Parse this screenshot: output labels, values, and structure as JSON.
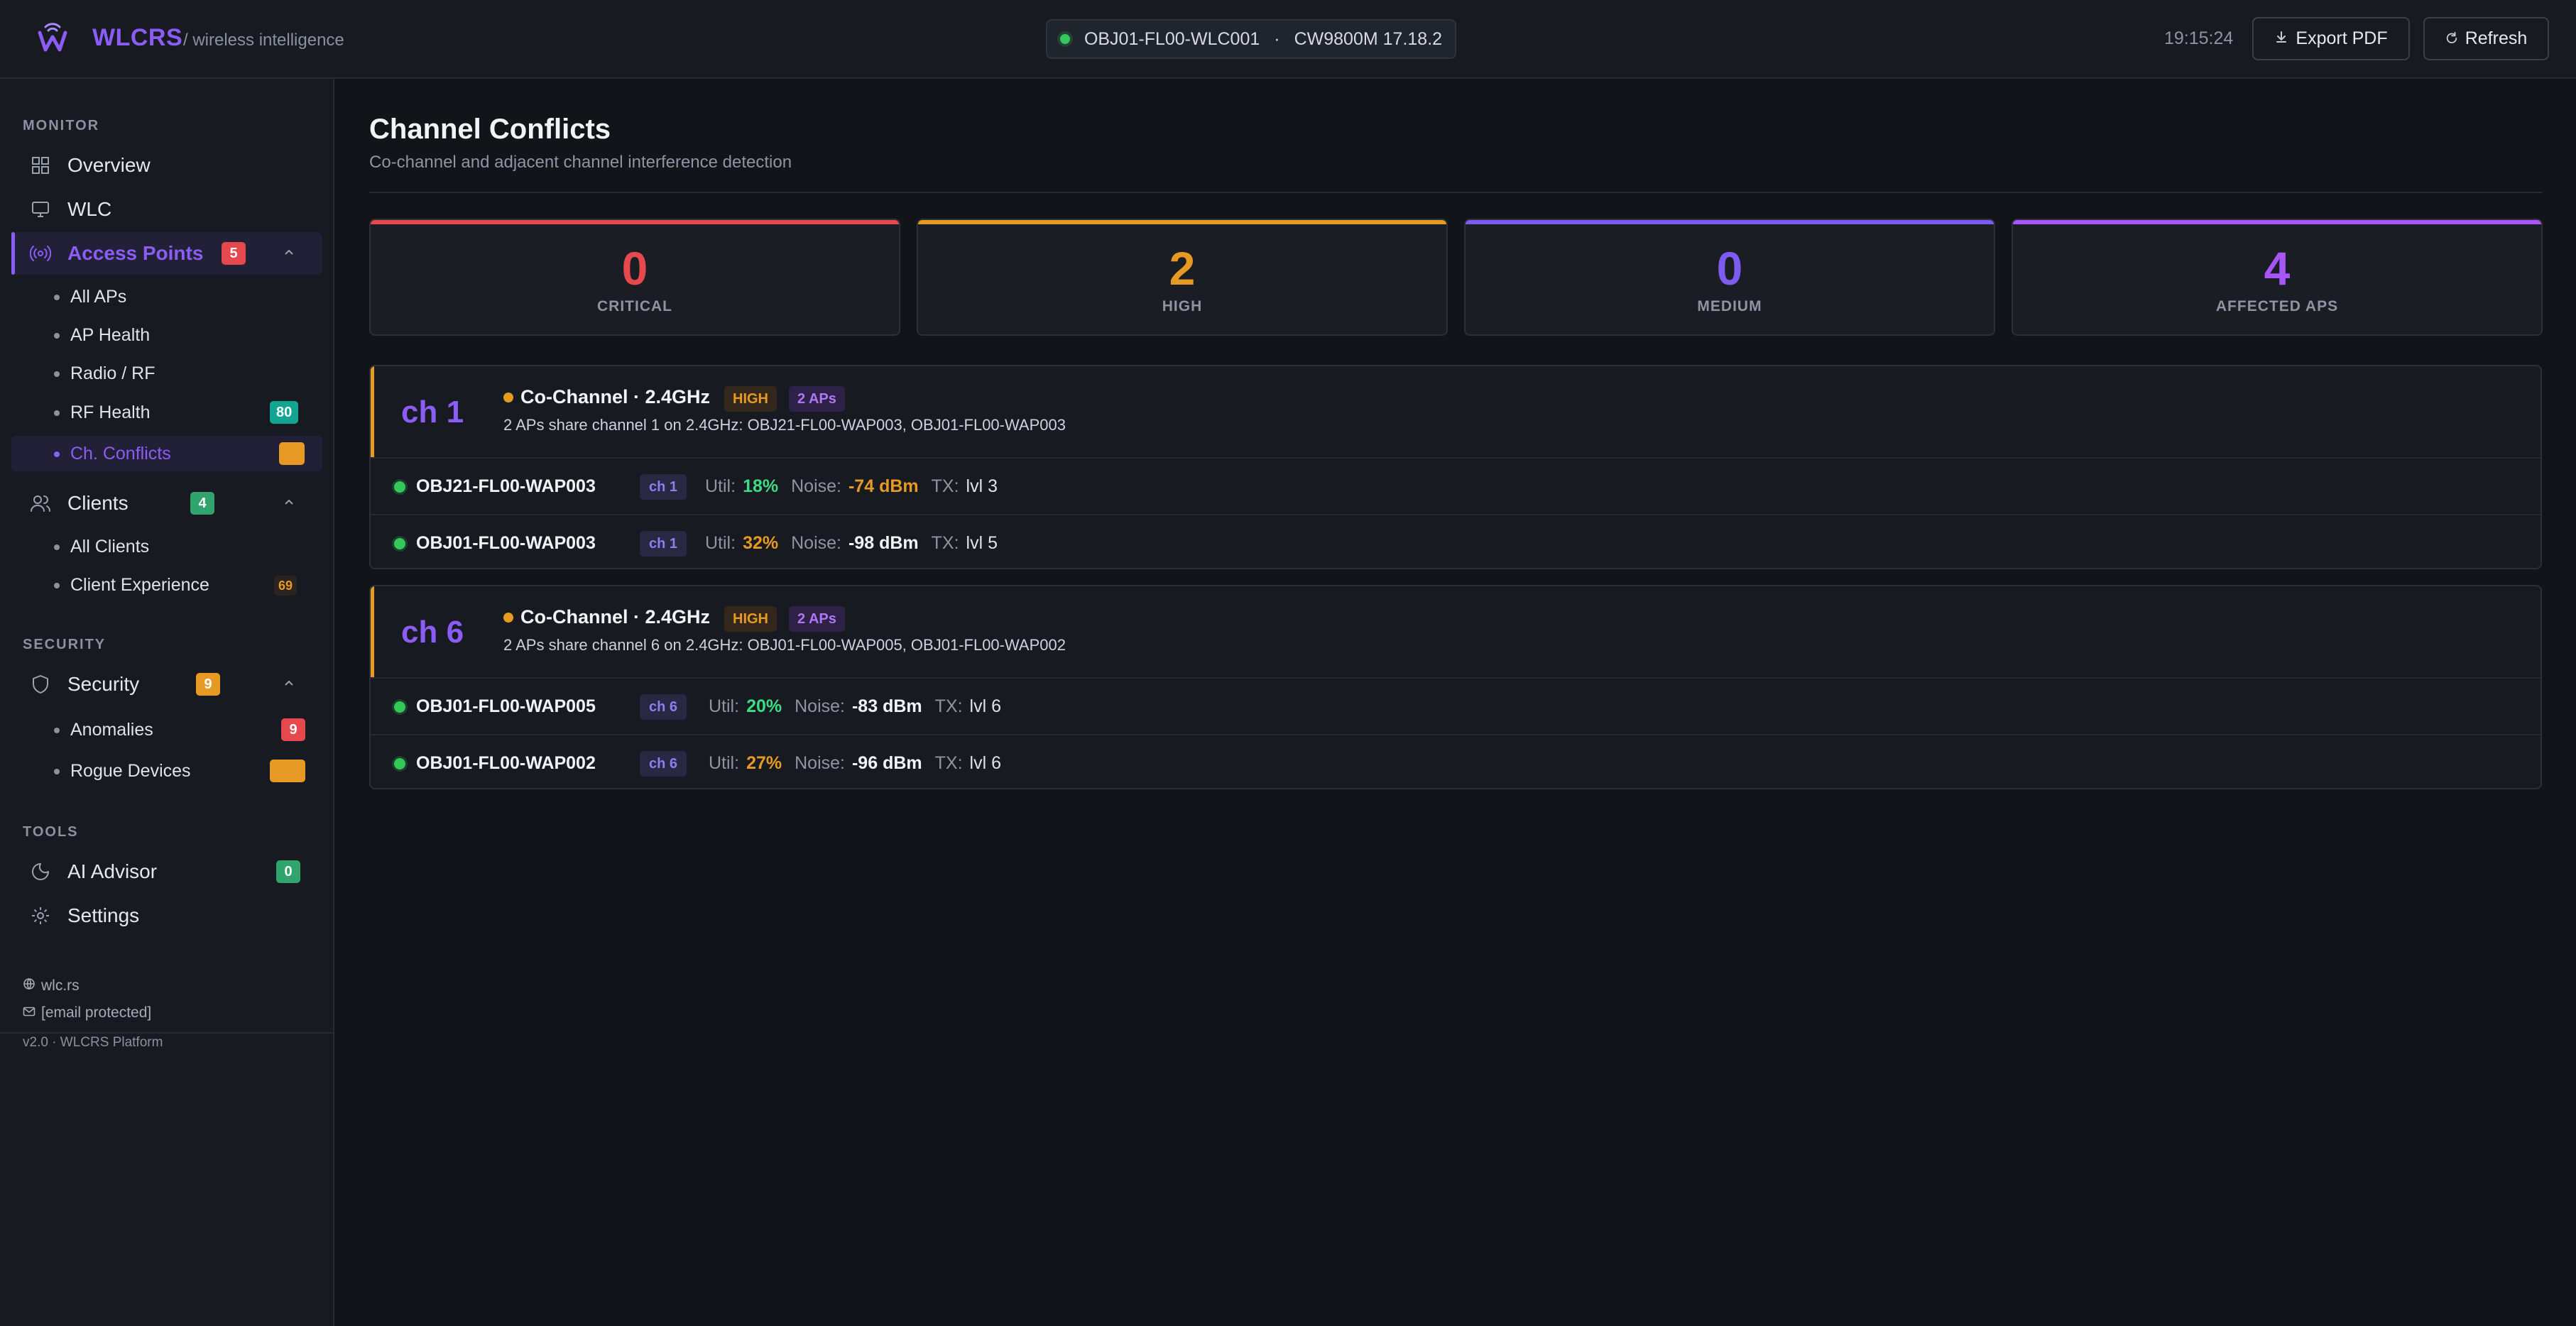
{
  "header": {
    "brand": "WLCRS",
    "brand_sub": "/ wireless intelligence",
    "controller_name": "OBJ01-FL00-WLC001",
    "separator": "·",
    "controller_version": "CW9800M 17.18.2",
    "clock": "19:15:24",
    "export_label": "Export PDF",
    "refresh_label": "Refresh"
  },
  "sidebar": {
    "monitor_title": "MONITOR",
    "security_title": "SECURITY",
    "tools_title": "TOOLS",
    "overview": "Overview",
    "wlc": "WLC",
    "access_points": {
      "label": "Access Points",
      "badge": "5"
    },
    "ap_sub": [
      {
        "label": "All APs",
        "badge": ""
      },
      {
        "label": "AP Health",
        "badge": ""
      },
      {
        "label": "Radio / RF",
        "badge": ""
      },
      {
        "label": "RF Health",
        "badge": "80"
      },
      {
        "label": "Ch. Conflicts",
        "badge": ""
      }
    ],
    "clients": {
      "label": "Clients",
      "badge": "4"
    },
    "client_sub": [
      {
        "label": "All Clients",
        "badge": ""
      },
      {
        "label": "Client Experience",
        "badge": "69"
      }
    ],
    "security": {
      "label": "Security",
      "badge": "9"
    },
    "security_sub": [
      {
        "label": "Anomalies",
        "badge": "9"
      },
      {
        "label": "Rogue Devices",
        "badge": ""
      }
    ],
    "ai_advisor": {
      "label": "AI Advisor",
      "badge": "0"
    },
    "settings": "Settings",
    "footer": {
      "site": "wlc.rs",
      "email": "[email protected]",
      "version": "v2.0 · WLCRS Platform"
    }
  },
  "page": {
    "title": "Channel Conflicts",
    "subtitle": "Co-channel and adjacent channel interference detection"
  },
  "stats": [
    {
      "value": "0",
      "label": "CRITICAL",
      "color": "#e5484d"
    },
    {
      "value": "2",
      "label": "HIGH",
      "color": "#e79a23"
    },
    {
      "value": "0",
      "label": "MEDIUM",
      "color": "#7c5cf0"
    },
    {
      "value": "4",
      "label": "AFFECTED APS",
      "color": "#a855f7"
    }
  ],
  "conflicts": [
    {
      "channel": "ch 1",
      "type": "Co-Channel · 2.4GHz",
      "severity": "HIGH",
      "ap_count": "2 APs",
      "description": "2 APs share channel 1 on 2.4GHz: OBJ21-FL00-WAP003, OBJ01-FL00-WAP003",
      "aps": [
        {
          "name": "OBJ21-FL00-WAP003",
          "channel": "ch 1",
          "util_label": "Util:",
          "util": "18%",
          "noise_label": "Noise:",
          "noise": "-74 dBm",
          "tx_label": "TX:",
          "tx": "lvl 3"
        },
        {
          "name": "OBJ01-FL00-WAP003",
          "channel": "ch 1",
          "util_label": "Util:",
          "util": "32%",
          "noise_label": "Noise:",
          "noise": "-98 dBm",
          "tx_label": "TX:",
          "tx": "lvl 5"
        }
      ]
    },
    {
      "channel": "ch 6",
      "type": "Co-Channel · 2.4GHz",
      "severity": "HIGH",
      "ap_count": "2 APs",
      "description": "2 APs share channel 6 on 2.4GHz: OBJ01-FL00-WAP005, OBJ01-FL00-WAP002",
      "aps": [
        {
          "name": "OBJ01-FL00-WAP005",
          "channel": "ch 6",
          "util_label": "Util:",
          "util": "20%",
          "noise_label": "Noise:",
          "noise": "-83 dBm",
          "tx_label": "TX:",
          "tx": "lvl 6"
        },
        {
          "name": "OBJ01-FL00-WAP002",
          "channel": "ch 6",
          "util_label": "Util:",
          "util": "27%",
          "noise_label": "Noise:",
          "noise": "-96 dBm",
          "tx_label": "TX:",
          "tx": "lvl 6"
        }
      ]
    }
  ]
}
